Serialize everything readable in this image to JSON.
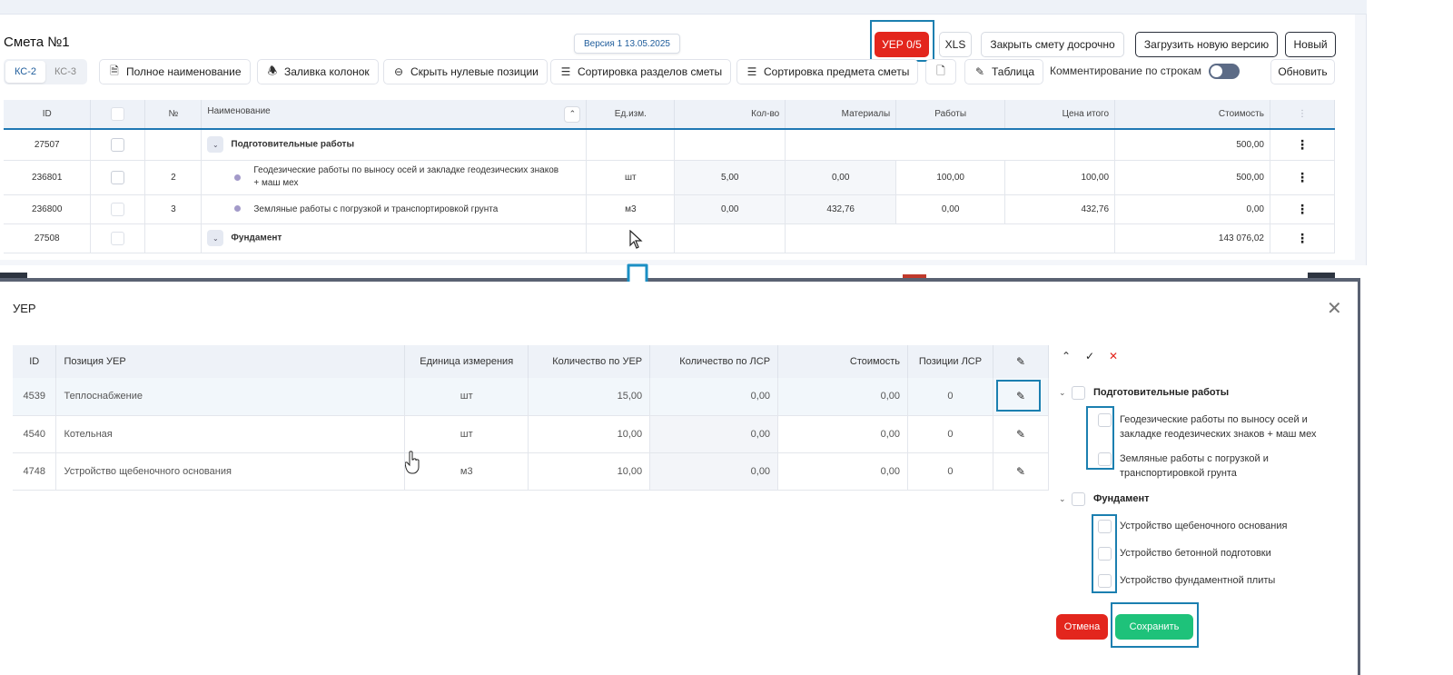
{
  "estimate": {
    "title": "Смета №1",
    "version": "Версия 1 13.05.2025",
    "buttons": {
      "uer": "УЕР 0/5",
      "xls": "XLS",
      "close_early": "Закрыть смету досрочно",
      "upload_version": "Загрузить новую версию",
      "new": "Новый",
      "refresh": "Обновить"
    },
    "tabs": [
      {
        "label": "КС-2",
        "active": true
      },
      {
        "label": "КС-3",
        "active": false
      }
    ],
    "toolbar": {
      "full_name": "Полное наименование",
      "fill_columns": "Заливка колонок",
      "hide_zero": "Скрыть нулевые позиции",
      "sort_sections": "Сортировка разделов сметы",
      "sort_subject": "Сортировка предмета сметы",
      "table": "Таблица",
      "row_comments": "Комментирование по строкам"
    },
    "columns": [
      "ID",
      "№",
      "Наименование",
      "Ед.изм.",
      "Кол-во",
      "Материалы",
      "Работы",
      "Цена итого",
      "Стоимость"
    ],
    "rows": [
      {
        "id": "27507",
        "num": "",
        "name": "Подготовительные работы",
        "unit": "",
        "qty": "",
        "materials": "",
        "works": "",
        "price": "",
        "cost": "500,00"
      },
      {
        "id": "236801",
        "num": "2",
        "name": "Геодезические работы по выносу осей и закладке геодезических знаков + маш мех",
        "unit": "шт",
        "qty": "5,00",
        "materials": "0,00",
        "works": "100,00",
        "price": "100,00",
        "cost": "500,00"
      },
      {
        "id": "236800",
        "num": "3",
        "name": "Земляные работы с погрузкой и транспортировкой грунта",
        "unit": "м3",
        "qty": "0,00",
        "materials": "432,76",
        "works": "0,00",
        "price": "432,76",
        "cost": "0,00"
      },
      {
        "id": "27508",
        "num": "",
        "name": "Фундамент",
        "unit": "",
        "qty": "",
        "materials": "",
        "works": "",
        "price": "",
        "cost": "143 076,02"
      }
    ]
  },
  "modal": {
    "title": "УЕР",
    "columns": [
      "ID",
      "Позиция УЕР",
      "Единица измерения",
      "Количество по УЕР",
      "Количество по ЛСР",
      "Стоимость",
      "Позиции ЛСР"
    ],
    "rows": [
      {
        "id": "4539",
        "position": "Теплоснабжение",
        "unit": "шт",
        "qty_uer": "15,00",
        "qty_lsr": "0,00",
        "cost": "0,00",
        "lsr_positions": "0"
      },
      {
        "id": "4540",
        "position": "Котельная",
        "unit": "шт",
        "qty_uer": "10,00",
        "qty_lsr": "0,00",
        "cost": "0,00",
        "lsr_positions": "0"
      },
      {
        "id": "4748",
        "position": "Устройство щебеночного основания",
        "unit": "м3",
        "qty_uer": "10,00",
        "qty_lsr": "0,00",
        "cost": "0,00",
        "lsr_positions": "0"
      }
    ],
    "tree": [
      {
        "label": "Подготовительные работы",
        "children": [
          "Геодезические работы по выносу осей и закладке геодезических знаков + маш мех",
          "Земляные работы с погрузкой и транспортировкой грунта"
        ]
      },
      {
        "label": "Фундамент",
        "children": [
          "Устройство щебеночного основания",
          "Устройство бетонной подготовки",
          "Устройство фундаментной плиты"
        ]
      }
    ],
    "cancel_label": "Отмена",
    "save_label": "Сохранить"
  },
  "colors": {
    "accent_red": "#e3261d",
    "accent_green": "#1ec27a",
    "highlight": "#1b7fb0",
    "link_blue": "#1f5d9c"
  }
}
